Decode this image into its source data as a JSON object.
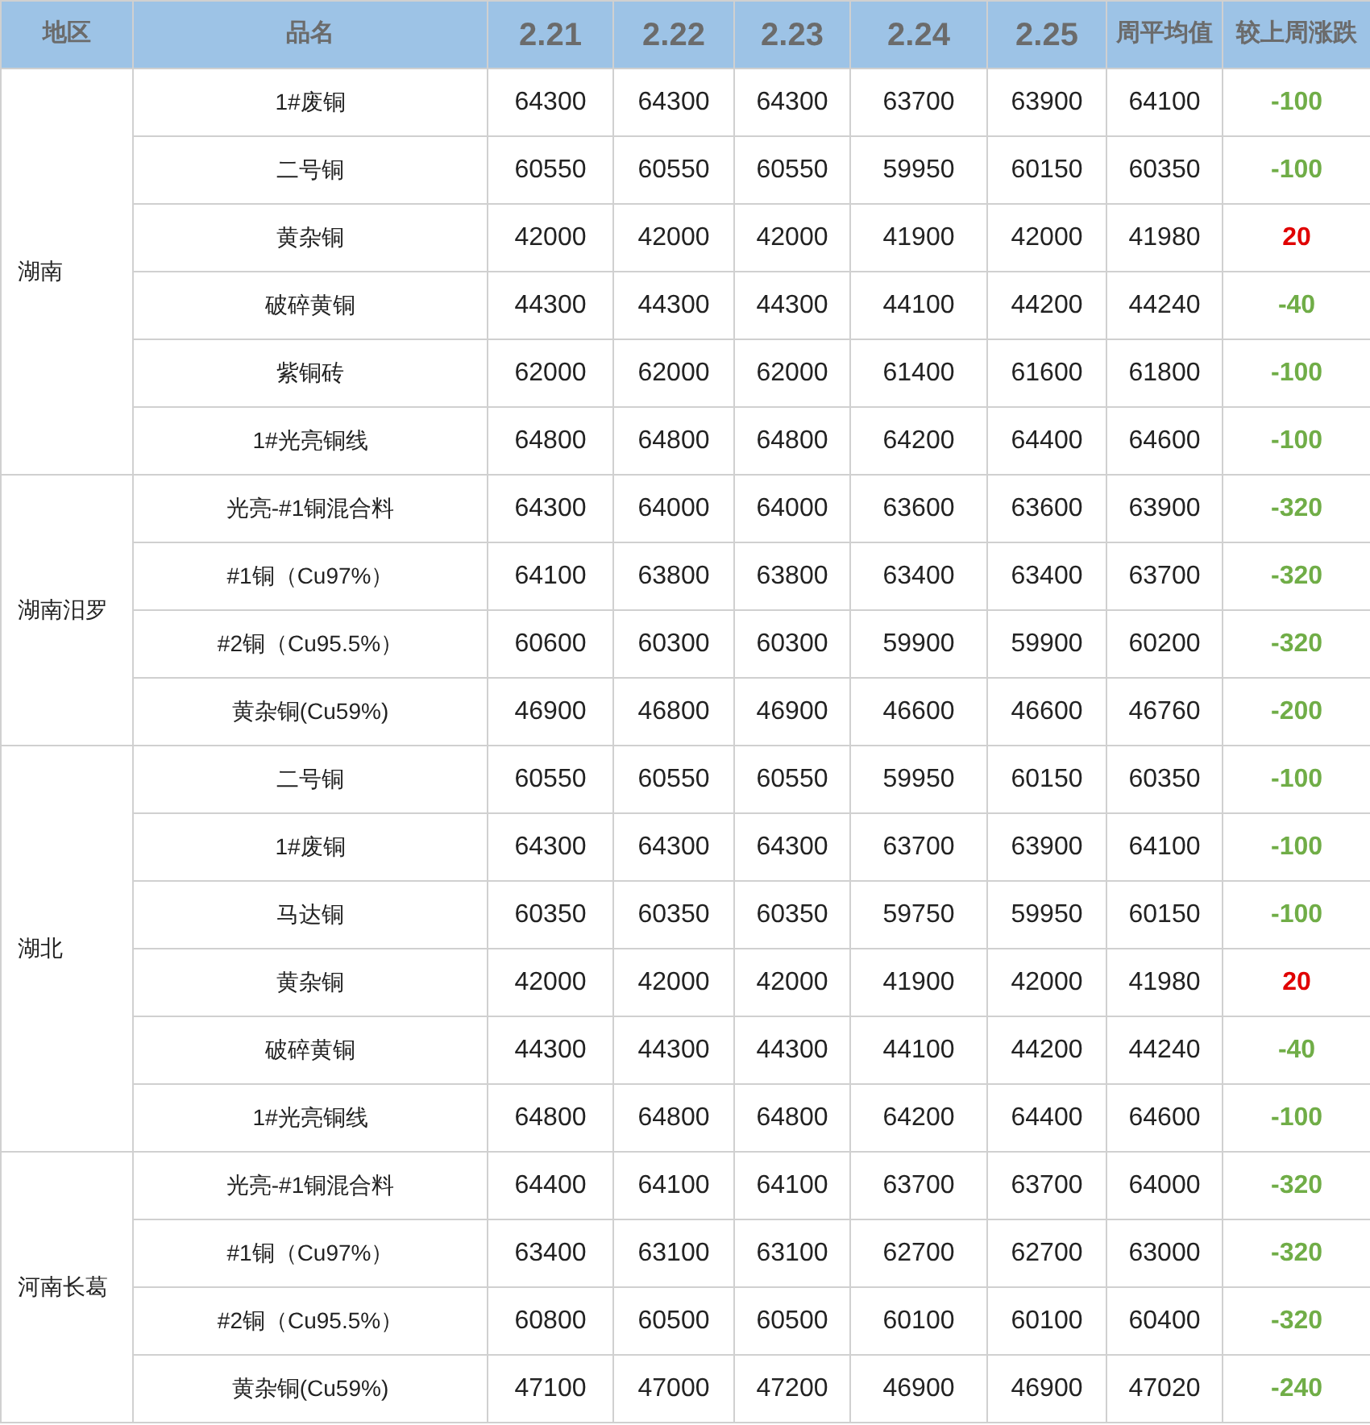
{
  "columns": [
    "地区",
    "品名",
    "2.21",
    "2.22",
    "2.23",
    "2.24",
    "2.25",
    "周平均值",
    "较上周涨跌"
  ],
  "groups": [
    {
      "region": "湖南",
      "rows": [
        {
          "name": "1#废铜",
          "prices": [
            "64300",
            "64300",
            "64300",
            "63700",
            "63900"
          ],
          "average": "64100",
          "change": {
            "text": "-100",
            "color": "#70ad47"
          }
        },
        {
          "name": "二号铜",
          "prices": [
            "60550",
            "60550",
            "60550",
            "59950",
            "60150"
          ],
          "average": "60350",
          "change": {
            "text": "-100",
            "color": "#70ad47"
          }
        },
        {
          "name": "黄杂铜",
          "prices": [
            "42000",
            "42000",
            "42000",
            "41900",
            "42000"
          ],
          "average": "41980",
          "change": {
            "text": "20",
            "color": "#e00000"
          }
        },
        {
          "name": "破碎黄铜",
          "prices": [
            "44300",
            "44300",
            "44300",
            "44100",
            "44200"
          ],
          "average": "44240",
          "change": {
            "text": "-40",
            "color": "#70ad47"
          }
        },
        {
          "name": "紫铜砖",
          "prices": [
            "62000",
            "62000",
            "62000",
            "61400",
            "61600"
          ],
          "average": "61800",
          "change": {
            "text": "-100",
            "color": "#70ad47"
          }
        },
        {
          "name": "1#光亮铜线",
          "prices": [
            "64800",
            "64800",
            "64800",
            "64200",
            "64400"
          ],
          "average": "64600",
          "change": {
            "text": "-100",
            "color": "#70ad47"
          }
        }
      ]
    },
    {
      "region": "湖南汨罗",
      "rows": [
        {
          "name": "光亮-#1铜混合料",
          "prices": [
            "64300",
            "64000",
            "64000",
            "63600",
            "63600"
          ],
          "average": "63900",
          "change": {
            "text": "-320",
            "color": "#70ad47"
          }
        },
        {
          "name": "#1铜（Cu97%）",
          "prices": [
            "64100",
            "63800",
            "63800",
            "63400",
            "63400"
          ],
          "average": "63700",
          "change": {
            "text": "-320",
            "color": "#70ad47"
          }
        },
        {
          "name": "#2铜（Cu95.5%）",
          "prices": [
            "60600",
            "60300",
            "60300",
            "59900",
            "59900"
          ],
          "average": "60200",
          "change": {
            "text": "-320",
            "color": "#70ad47"
          }
        },
        {
          "name": "黄杂铜(Cu59%)",
          "prices": [
            "46900",
            "46800",
            "46900",
            "46600",
            "46600"
          ],
          "average": "46760",
          "change": {
            "text": "-200",
            "color": "#70ad47"
          }
        }
      ]
    },
    {
      "region": "湖北",
      "rows": [
        {
          "name": "二号铜",
          "prices": [
            "60550",
            "60550",
            "60550",
            "59950",
            "60150"
          ],
          "average": "60350",
          "change": {
            "text": "-100",
            "color": "#70ad47"
          }
        },
        {
          "name": "1#废铜",
          "prices": [
            "64300",
            "64300",
            "64300",
            "63700",
            "63900"
          ],
          "average": "64100",
          "change": {
            "text": "-100",
            "color": "#70ad47"
          }
        },
        {
          "name": "马达铜",
          "prices": [
            "60350",
            "60350",
            "60350",
            "59750",
            "59950"
          ],
          "average": "60150",
          "change": {
            "text": "-100",
            "color": "#70ad47"
          }
        },
        {
          "name": "黄杂铜",
          "prices": [
            "42000",
            "42000",
            "42000",
            "41900",
            "42000"
          ],
          "average": "41980",
          "change": {
            "text": "20",
            "color": "#e00000"
          }
        },
        {
          "name": "破碎黄铜",
          "prices": [
            "44300",
            "44300",
            "44300",
            "44100",
            "44200"
          ],
          "average": "44240",
          "change": {
            "text": "-40",
            "color": "#70ad47"
          }
        },
        {
          "name": "1#光亮铜线",
          "prices": [
            "64800",
            "64800",
            "64800",
            "64200",
            "64400"
          ],
          "average": "64600",
          "change": {
            "text": "-100",
            "color": "#70ad47"
          }
        }
      ]
    },
    {
      "region": "河南长葛",
      "rows": [
        {
          "name": "光亮-#1铜混合料",
          "prices": [
            "64400",
            "64100",
            "64100",
            "63700",
            "63700"
          ],
          "average": "64000",
          "change": {
            "text": "-320",
            "color": "#70ad47"
          }
        },
        {
          "name": "#1铜（Cu97%）",
          "prices": [
            "63400",
            "63100",
            "63100",
            "62700",
            "62700"
          ],
          "average": "63000",
          "change": {
            "text": "-320",
            "color": "#70ad47"
          }
        },
        {
          "name": "#2铜（Cu95.5%）",
          "prices": [
            "60800",
            "60500",
            "60500",
            "60100",
            "60100"
          ],
          "average": "60400",
          "change": {
            "text": "-320",
            "color": "#70ad47"
          }
        },
        {
          "name": "黄杂铜(Cu59%)",
          "prices": [
            "47100",
            "47000",
            "47200",
            "46900",
            "46900"
          ],
          "average": "47020",
          "change": {
            "text": "-240",
            "color": "#70ad47"
          }
        }
      ]
    }
  ]
}
